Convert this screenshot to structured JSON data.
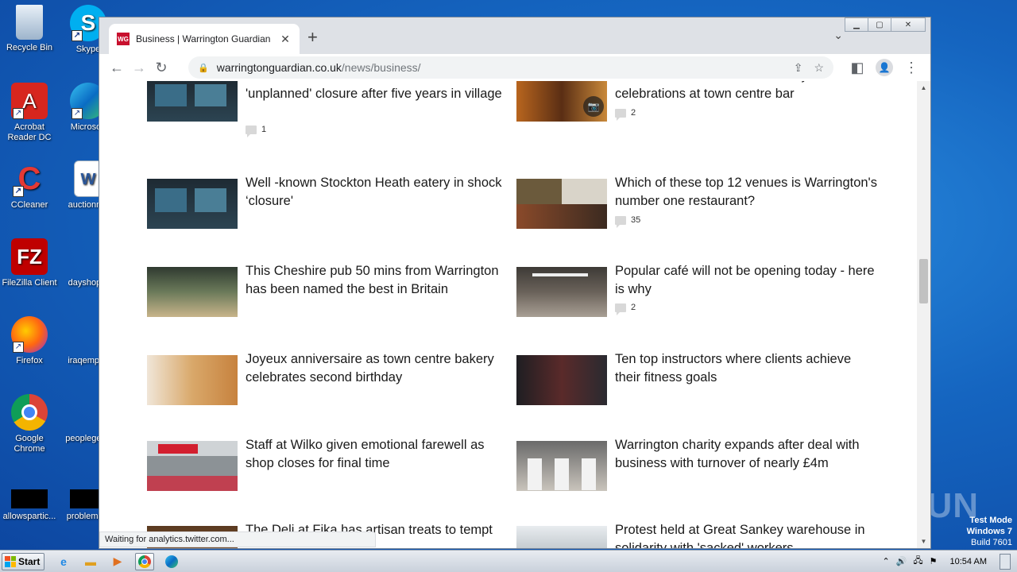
{
  "desktop": {
    "icons": [
      {
        "label": "Recycle Bin"
      },
      {
        "label": "Skype"
      },
      {
        "label": "Acrobat Reader DC"
      },
      {
        "label": "Microsoft"
      },
      {
        "label": "CCleaner"
      },
      {
        "label": "auctionme"
      },
      {
        "label": "FileZilla Client"
      },
      {
        "label": "dayshop..."
      },
      {
        "label": "Firefox"
      },
      {
        "label": "iraqempl..."
      },
      {
        "label": "Google Chrome"
      },
      {
        "label": "peopleget..."
      },
      {
        "label": "allowspartic..."
      },
      {
        "label": "problems..."
      }
    ],
    "watermark": "ANY RUN",
    "test_mode": {
      "line1": "Test Mode",
      "line2": "Windows 7",
      "line3": "Build 7601"
    }
  },
  "browser": {
    "tab_title": "Business | Warrington Guardian",
    "favicon_text": "WG",
    "url_host": "warringtonguardian.co.uk",
    "url_path": "/news/business/",
    "status_text": "Waiting for analytics.twitter.com..."
  },
  "articles": [
    {
      "headline": "Stockton Heath business confirms 'unplanned' closure after five years in village",
      "comments": "1"
    },
    {
      "headline": "Union Jack Vanbar - first birthday celebrations at town centre bar",
      "comments": "2"
    },
    {
      "headline": "Well -known Stockton Heath eatery in shock ‘closure'",
      "comments": ""
    },
    {
      "headline": "Which of these top 12 venues is Warrington's number one restaurant?",
      "comments": "35"
    },
    {
      "headline": "This Cheshire pub 50 mins from Warrington has been named the best in Britain",
      "comments": ""
    },
    {
      "headline": "Popular café will not be opening today - here is why",
      "comments": "2"
    },
    {
      "headline": "Joyeux anniversaire as town centre bakery celebrates second birthday",
      "comments": ""
    },
    {
      "headline": "Ten top instructors where clients achieve their fitness goals",
      "comments": ""
    },
    {
      "headline": "Staff at Wilko given emotional farewell as shop closes for final time",
      "comments": ""
    },
    {
      "headline": "Warrington charity expands after deal with business with turnover of nearly £4m",
      "comments": ""
    },
    {
      "headline": "The Deli at Fika has artisan treats to tempt",
      "comments": ""
    },
    {
      "headline": "Protest held at Great Sankey warehouse in solidarity with 'sacked' workers",
      "comments": ""
    }
  ],
  "taskbar": {
    "start_label": "Start",
    "clock": "10:54 AM"
  }
}
